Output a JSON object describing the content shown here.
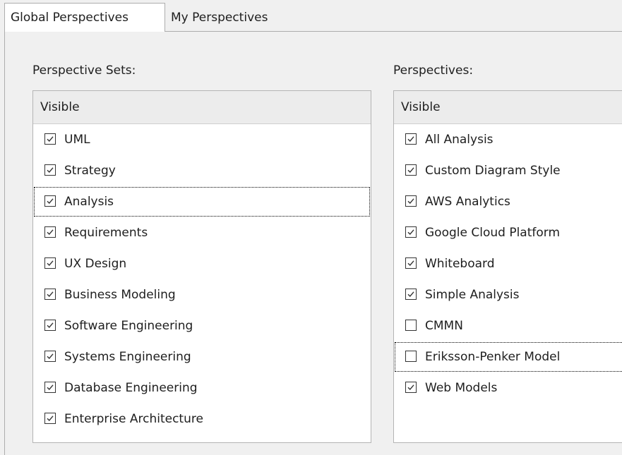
{
  "tabs": [
    {
      "label": "Global Perspectives",
      "active": true
    },
    {
      "label": "My Perspectives",
      "active": false
    }
  ],
  "left": {
    "section_label": "Perspective Sets:",
    "column_header": "Visible",
    "items": [
      {
        "label": "UML",
        "checked": true
      },
      {
        "label": "Strategy",
        "checked": true
      },
      {
        "label": "Analysis",
        "checked": true,
        "focused": true
      },
      {
        "label": "Requirements",
        "checked": true
      },
      {
        "label": "UX Design",
        "checked": true
      },
      {
        "label": "Business Modeling",
        "checked": true
      },
      {
        "label": "Software Engineering",
        "checked": true
      },
      {
        "label": "Systems Engineering",
        "checked": true
      },
      {
        "label": "Database Engineering",
        "checked": true
      },
      {
        "label": "Enterprise Architecture",
        "checked": true
      }
    ]
  },
  "right": {
    "section_label": "Perspectives:",
    "column_header": "Visible",
    "items": [
      {
        "label": "All Analysis",
        "checked": true
      },
      {
        "label": "Custom Diagram Style",
        "checked": true
      },
      {
        "label": "AWS Analytics",
        "checked": true
      },
      {
        "label": "Google Cloud Platform",
        "checked": true
      },
      {
        "label": "Whiteboard",
        "checked": true
      },
      {
        "label": "Simple Analysis",
        "checked": true
      },
      {
        "label": "CMMN",
        "checked": false
      },
      {
        "label": "Eriksson-Penker Model",
        "checked": false,
        "focused": true
      },
      {
        "label": "Web Models",
        "checked": true
      }
    ]
  }
}
